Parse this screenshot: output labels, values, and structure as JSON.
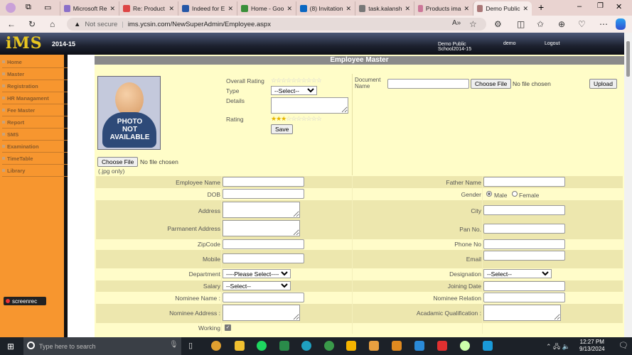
{
  "browser": {
    "tabs": [
      {
        "label": "Microsoft Re",
        "color": "#8a6fc9"
      },
      {
        "label": "Re: Product",
        "color": "#d44"
      },
      {
        "label": "Indeed for E",
        "color": "#2557a7"
      },
      {
        "label": "Home - Goo",
        "color": "#3a8f3a"
      },
      {
        "label": "(8) Invitation",
        "color": "#0a66c2"
      },
      {
        "label": "task.kalansh",
        "color": "#777"
      },
      {
        "label": "Products ima",
        "color": "#c79"
      },
      {
        "label": "Demo Public",
        "color": "#a77"
      }
    ],
    "not_secure": "Not secure",
    "url": "ims.ycsin.com/NewSuperAdmin/Employee.aspx"
  },
  "header": {
    "logo": "iMS",
    "year": "2014-15",
    "school": "Demo Public School2014-15",
    "user": "demo",
    "logout": "Logout"
  },
  "sidebar": {
    "items": [
      "Home",
      "Master",
      "Registration",
      "HR Managament",
      "Fee Master",
      "Report",
      "SMS",
      "Examination",
      "TimeTable",
      "Library"
    ],
    "screenrec": "screenrec"
  },
  "page": {
    "title": "Employee Master",
    "photo_text": [
      "PHOTO",
      "NOT",
      "AVAILABLE"
    ],
    "choose_file": "Choose File",
    "no_file": "No file chosen",
    "jpg_only": "(.jpg only)",
    "overall_rating": "Overall Rating",
    "overall_rating_value": 0,
    "type": "Type",
    "type_value": "--Select--",
    "details": "Details",
    "rating": "Rating",
    "rating_value": 3,
    "rating_max": 10,
    "save": "Save",
    "document_name": "Document Name",
    "upload": "Upload"
  },
  "form": {
    "employee_name": "Employee Name",
    "dob": "DOB",
    "address": "Address",
    "parm_address": "Parmanent Address",
    "zipcode": "ZipCode",
    "mobile": "Mobile",
    "department": "Department",
    "department_value": "----Please Select----",
    "salary": "Salary",
    "salary_value": "--Select--",
    "nominee_name": "Nominee Name :",
    "nominee_address": "Nominee Address :",
    "working": "Working",
    "father_name": "Father Name",
    "gender": "Gender",
    "male": "Male",
    "female": "Female",
    "city": "City",
    "pan": "Pan No.",
    "phone": "Phone No",
    "email": "Email",
    "designation": "Designation",
    "designation_value": "--Select--",
    "joining_date": "Joining Date",
    "nominee_relation": "Nominee Relation",
    "qualification": "Acadamic Qualification :"
  },
  "taskbar": {
    "search_placeholder": "Type here to search",
    "time": "12:27 PM",
    "date": "9/13/2024"
  }
}
